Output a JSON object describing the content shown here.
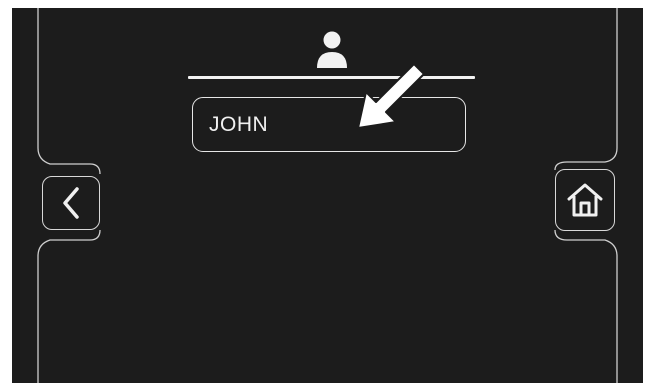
{
  "screen": {
    "background_color": "#1c1c1c",
    "line_color": "#e6e6e6"
  },
  "header": {
    "icon": "user-icon"
  },
  "name_field": {
    "value": "JOHN"
  },
  "annotation": {
    "icon": "pointer-arrow-icon",
    "color": "#ffffff"
  },
  "navigation": {
    "back_icon": "chevron-left-icon",
    "home_icon": "home-icon"
  }
}
